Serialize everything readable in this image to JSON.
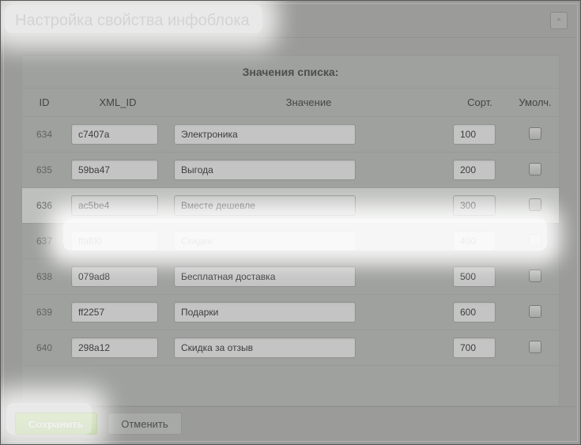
{
  "dialog": {
    "title": "Настройка свойства инфоблока"
  },
  "panel": {
    "header": "Значения списка:"
  },
  "columns": {
    "id": "ID",
    "xml": "XML_ID",
    "val": "Значение",
    "sort": "Сорт.",
    "def": "Умолч."
  },
  "rows": [
    {
      "id": "634",
      "xml": "c7407a",
      "val": "Электроника",
      "sort": "100",
      "def": false,
      "hilite": false
    },
    {
      "id": "635",
      "xml": "59ba47",
      "val": "Выгода",
      "sort": "200",
      "def": false,
      "hilite": false
    },
    {
      "id": "636",
      "xml": "ac5be4",
      "val": "Вместе дешевле",
      "sort": "300",
      "def": false,
      "hilite": true
    },
    {
      "id": "637",
      "xml": "ffaf00",
      "val": "Скидки",
      "sort": "400",
      "def": false,
      "hilite": false
    },
    {
      "id": "638",
      "xml": "079ad8",
      "val": "Бесплатная доставка",
      "sort": "500",
      "def": false,
      "hilite": false
    },
    {
      "id": "639",
      "xml": "ff2257",
      "val": "Подарки",
      "sort": "600",
      "def": false,
      "hilite": false
    },
    {
      "id": "640",
      "xml": "298a12",
      "val": "Скидка за отзыв",
      "sort": "700",
      "def": false,
      "hilite": false
    }
  ],
  "footer": {
    "save": "Сохранить",
    "cancel": "Отменить"
  },
  "win_close_glyph": "▫"
}
